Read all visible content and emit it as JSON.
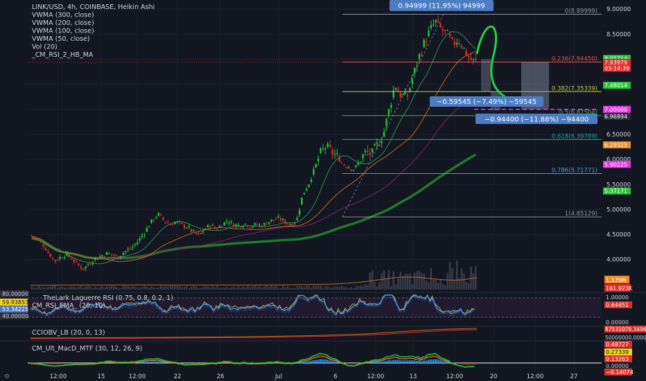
{
  "header": {
    "symbol_line": "LINK/USD, 4h, COINBASE, Heikin Ashi",
    "indicators": [
      "VWMA (300, close)",
      "VWMA (200, close)",
      "VWMA (100, close)",
      "VWMA (50, close)",
      "Vol (20)",
      "_CM_RSI_2_HB_MA"
    ]
  },
  "colors": {
    "background": "#131722",
    "grid": "#1e2230",
    "up": "#26c63a",
    "down": "#e0302c",
    "fib": "#8a8f9e",
    "pink": "#e536e5",
    "green_curve": "#22d34a",
    "box_label": "#4c7cc2"
  },
  "chart_data": [
    {
      "type": "candlestick",
      "title": "LINK/USD, 4h, COINBASE, Heikin Ashi",
      "y_axis_ticks": [
        "9.00000",
        "8.50000",
        "8.00000",
        "7.50000",
        "7.00000",
        "6.50000",
        "6.00000",
        "5.50000",
        "5.00000",
        "4.50000",
        "4.00000"
      ],
      "x_axis_ticks": [
        "12:00",
        "15",
        "12:00",
        "22",
        "26",
        "Jul",
        "6",
        "12:00",
        "13",
        "12:00",
        "20",
        "12:00",
        "27"
      ],
      "ylim": [
        3.65,
        9.1
      ],
      "price_path": [
        4.48,
        4.42,
        4.3,
        4.12,
        3.98,
        4.05,
        4.1,
        4.02,
        3.9,
        3.82,
        3.92,
        4.02,
        4.07,
        4.12,
        4.1,
        4.05,
        4.15,
        4.2,
        4.3,
        4.45,
        4.62,
        4.8,
        4.9,
        4.78,
        4.7,
        4.75,
        4.7,
        4.65,
        4.55,
        4.48,
        4.6,
        4.7,
        4.6,
        4.7,
        4.78,
        4.7,
        4.68,
        4.72,
        4.66,
        4.7,
        4.68,
        4.75,
        4.8,
        4.82,
        4.75,
        4.7,
        4.8,
        5.3,
        5.5,
        5.8,
        6.1,
        6.25,
        6.15,
        6.05,
        5.9,
        5.85,
        5.8,
        6.0,
        6.15,
        6.1,
        6.3,
        6.5,
        7.0,
        7.5,
        7.3,
        7.2,
        7.6,
        8.0,
        8.3,
        8.55,
        8.75,
        8.6,
        8.5,
        8.3,
        8.4,
        8.2,
        8.0,
        7.94
      ],
      "fib_levels": [
        {
          "label": "0(8.89999)",
          "value": 8.89999
        },
        {
          "label": "0.236(7.94450)",
          "value": 7.9445
        },
        {
          "label": "0.382(7.35339)",
          "value": 7.35339
        },
        {
          "label": "0.5(6.87504)",
          "value": 6.87504
        },
        {
          "label": "0.618(6.39789)",
          "value": 6.39789
        },
        {
          "label": "0.786(5.71771)",
          "value": 5.71771
        },
        {
          "label": "1(4.85129)",
          "value": 4.85129
        }
      ],
      "price_tags": [
        {
          "text": "8.01714",
          "value": 8.01714,
          "color": "#26c63a"
        },
        {
          "text": "7.93979",
          "value": 7.94,
          "color": "#e0302c"
        },
        {
          "text": "03:14:39",
          "value": 7.82,
          "color": "#e0302c"
        },
        {
          "text": "7.48014",
          "value": 7.48,
          "color": "#26c63a"
        },
        {
          "text": "7.00000",
          "value": 7.0,
          "color": "#e536e5"
        },
        {
          "text": "6.96894",
          "value": 6.86,
          "color": "#2b2f3d"
        },
        {
          "text": "6.29325",
          "value": 6.29,
          "color": "#f08a24"
        },
        {
          "text": "5.90225",
          "value": 5.9,
          "color": "#e536e5"
        },
        {
          "text": "5.37171",
          "value": 5.37,
          "color": "#26c63a"
        }
      ],
      "annotations": [
        {
          "text": "0.94999 (11.95%) 94999"
        },
        {
          "text": "−0.59545 (−7.49%) −59545"
        },
        {
          "text": "−0.94400 (−11.88%) −94400"
        }
      ],
      "volume_tags": [
        {
          "text": "1.176M",
          "color": "#f08a24"
        },
        {
          "text": "161.923K",
          "color": "#e0302c"
        }
      ]
    },
    {
      "type": "line",
      "title": "TheLark Laguerre RSI (0.75, 0.8, 0.2, 1)",
      "subtitle": "CM_RSI_EMA_ (20, 10)",
      "left_tags": [
        "80.00000",
        "59.93853",
        "53.34225",
        "40.00000"
      ],
      "right_ticks": [
        "1.00000",
        "0.00000"
      ],
      "right_tag": "0.64451"
    },
    {
      "type": "line",
      "title": "CCIOBV_LB (20, 0, 13)",
      "right_tag": "87531079.34966",
      "right_tick": "50000000.000000"
    },
    {
      "type": "bar",
      "title": "CM_Ult_MacD_MTF (30, 12, 26, 9)",
      "right_tags": [
        {
          "text": "0.48727",
          "color": "#e0302c"
        },
        {
          "text": "0.27339",
          "color": "#f2d21b"
        },
        {
          "text": "0.13263",
          "color": "#e0302c"
        },
        {
          "text": "0.00000",
          "color": "#ffffff"
        },
        {
          "text": "−0.14074",
          "color": "#e0302c"
        }
      ]
    }
  ]
}
